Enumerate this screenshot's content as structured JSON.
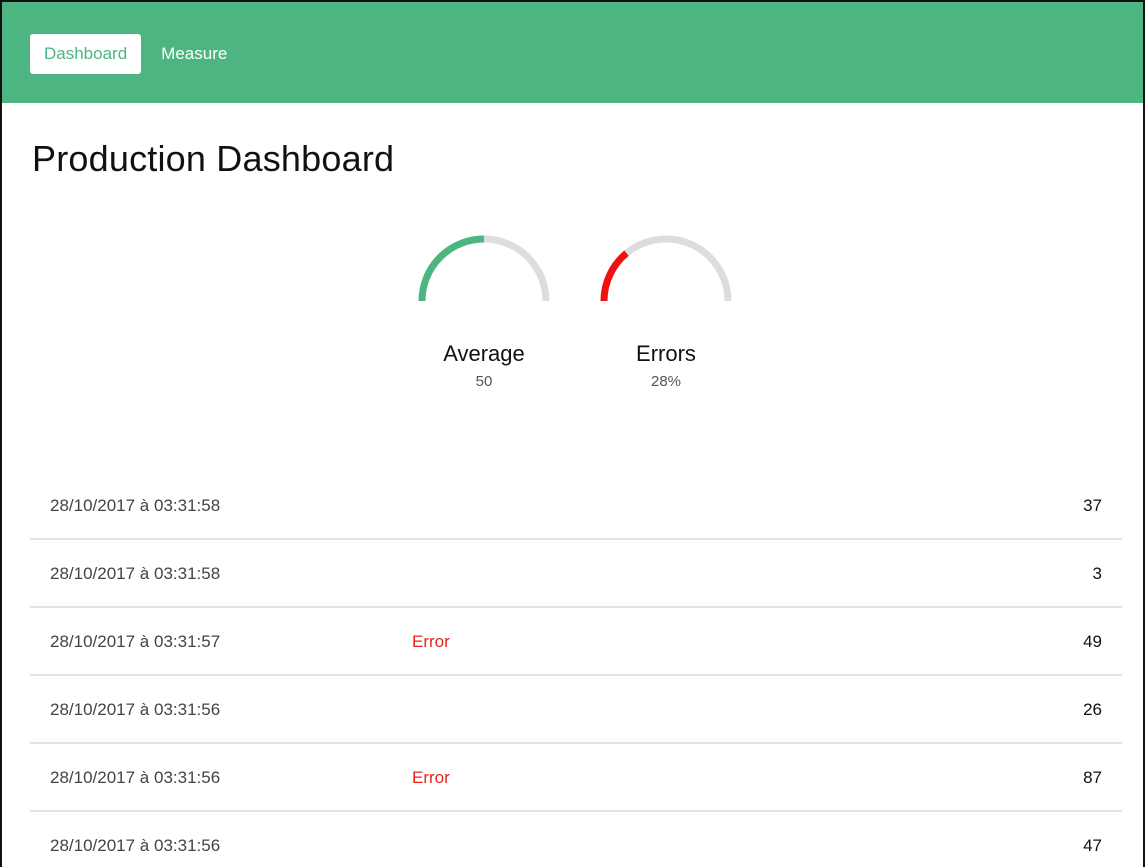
{
  "colors": {
    "brand": "#4cb582",
    "error": "#e8231a",
    "gauge_track": "#dddddd"
  },
  "nav": {
    "items": [
      {
        "label": "Dashboard",
        "active": true
      },
      {
        "label": "Measure",
        "active": false
      }
    ]
  },
  "page": {
    "title": "Production Dashboard"
  },
  "gauges": [
    {
      "title": "Average",
      "value_text": "50",
      "fraction": 0.5,
      "color": "#4cb582"
    },
    {
      "title": "Errors",
      "value_text": "28%",
      "fraction": 0.28,
      "color": "#f01010"
    }
  ],
  "measures": [
    {
      "timestamp": "28/10/2017 à 03:31:58",
      "status": "",
      "value": "37"
    },
    {
      "timestamp": "28/10/2017 à 03:31:58",
      "status": "",
      "value": "3"
    },
    {
      "timestamp": "28/10/2017 à 03:31:57",
      "status": "Error",
      "value": "49"
    },
    {
      "timestamp": "28/10/2017 à 03:31:56",
      "status": "",
      "value": "26"
    },
    {
      "timestamp": "28/10/2017 à 03:31:56",
      "status": "Error",
      "value": "87"
    },
    {
      "timestamp": "28/10/2017 à 03:31:56",
      "status": "",
      "value": "47"
    }
  ]
}
